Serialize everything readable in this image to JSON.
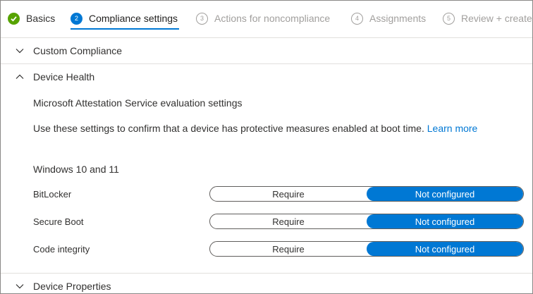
{
  "wizard": {
    "steps": [
      {
        "number": "",
        "label": "Basics",
        "state": "done"
      },
      {
        "number": "2",
        "label": "Compliance settings",
        "state": "active"
      },
      {
        "number": "3",
        "label": "Actions for noncompliance",
        "state": "pending"
      },
      {
        "number": "4",
        "label": "Assignments",
        "state": "pending"
      },
      {
        "number": "5",
        "label": "Review + create",
        "state": "pending"
      }
    ]
  },
  "sections": {
    "custom_compliance": {
      "title": "Custom Compliance",
      "expanded": false
    },
    "device_health": {
      "title": "Device Health",
      "expanded": true,
      "subtitle": "Microsoft Attestation Service evaluation settings",
      "description": "Use these settings to confirm that a device has protective measures enabled at boot time.",
      "learn_more": "Learn more",
      "group_label": "Windows 10 and 11",
      "settings": [
        {
          "label": "BitLocker",
          "option_a": "Require",
          "option_b": "Not configured",
          "selected": "Not configured"
        },
        {
          "label": "Secure Boot",
          "option_a": "Require",
          "option_b": "Not configured",
          "selected": "Not configured"
        },
        {
          "label": "Code integrity",
          "option_a": "Require",
          "option_b": "Not configured",
          "selected": "Not configured"
        }
      ]
    },
    "device_properties": {
      "title": "Device Properties",
      "expanded": false
    }
  },
  "colors": {
    "accent": "#0078d4",
    "success": "#57a300",
    "muted": "#a19f9d"
  }
}
